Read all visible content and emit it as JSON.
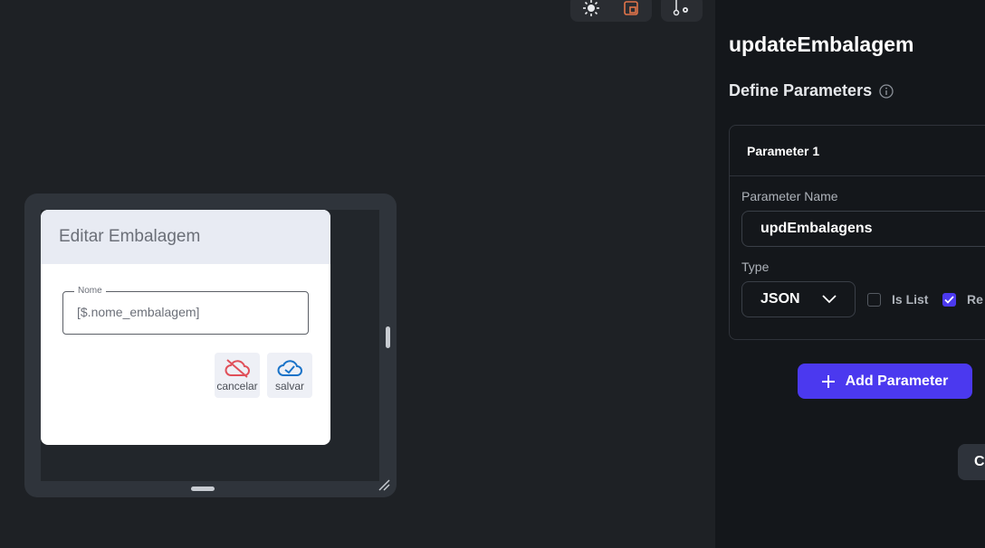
{
  "toolbar": {
    "icons": [
      "sun-icon",
      "layout-icon",
      "branch-settings-icon"
    ]
  },
  "dialog": {
    "title": "Editar Embalagem",
    "field": {
      "label": "Nome",
      "value": "[$.nome_embalagem]"
    },
    "actions": [
      {
        "label": "cancelar",
        "icon": "cloud-off-icon",
        "color": "#e0505a"
      },
      {
        "label": "salvar",
        "icon": "cloud-check-icon",
        "color": "#1a73c8"
      }
    ]
  },
  "panel": {
    "title": "updateEmbalagem",
    "section_title": "Define Parameters",
    "parameter": {
      "header": "Parameter 1",
      "name_label": "Parameter Name",
      "name_value": "updEmbalagens",
      "type_label": "Type",
      "type_value": "JSON",
      "is_list_label": "Is List",
      "is_list_checked": false,
      "required_label": "Re",
      "required_checked": true
    },
    "add_button": "Add Parameter",
    "bottom_button": "C"
  },
  "colors": {
    "accent": "#4b39ef",
    "panel_bg": "#14171b",
    "canvas_bg": "#1e2125"
  }
}
